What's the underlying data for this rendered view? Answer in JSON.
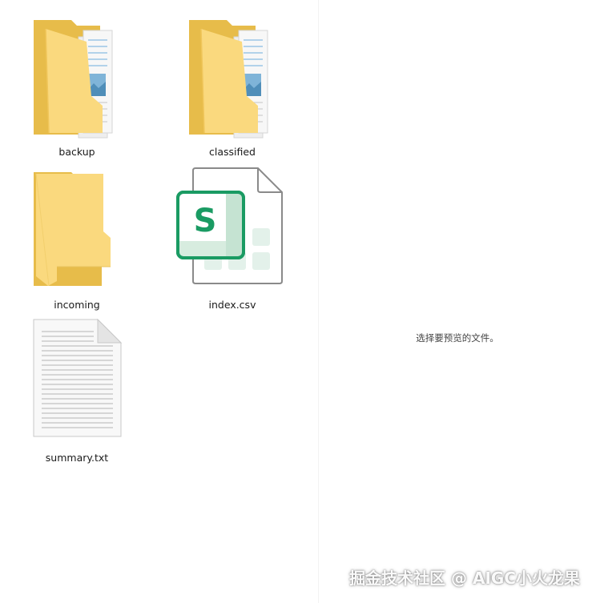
{
  "files": [
    {
      "label": "backup",
      "icon": "folder-with-documents-icon"
    },
    {
      "label": "classified",
      "icon": "folder-with-documents-icon"
    },
    {
      "label": "incoming",
      "icon": "empty-folder-icon"
    },
    {
      "label": "index.csv",
      "icon": "spreadsheet-file-icon"
    },
    {
      "label": "summary.txt",
      "icon": "text-file-icon"
    }
  ],
  "preview": {
    "message": "选择要预览的文件。"
  },
  "watermark": "掘金技术社区 @ AIGC小火龙果",
  "colors": {
    "folder_back": "#e7bc4a",
    "folder_front": "#fad97e",
    "spreadsheet_green": "#1a9b63",
    "file_outline": "#8a8a8a"
  }
}
